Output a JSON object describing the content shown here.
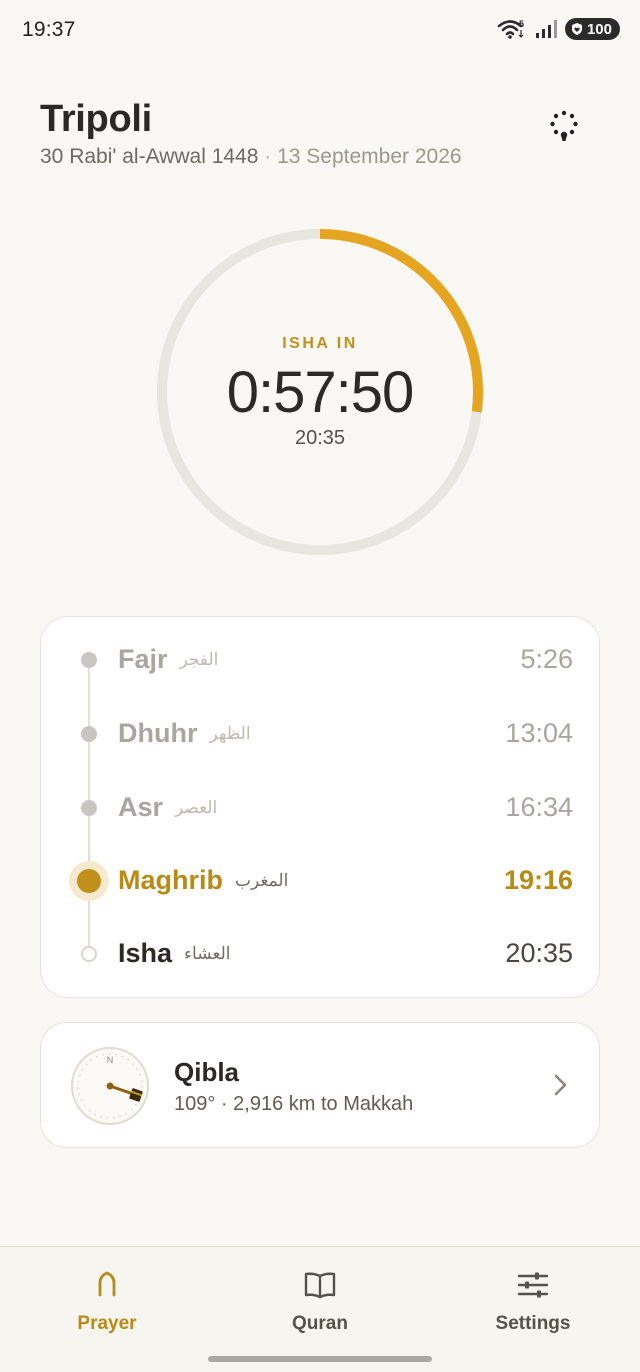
{
  "status_bar": {
    "time": "19:37",
    "battery": "100",
    "icons": [
      "wifi-icon",
      "signal-icon",
      "battery-icon"
    ]
  },
  "header": {
    "city": "Tripoli",
    "hijri_date": "30 Rabi' al-Awwal 1448",
    "separator": "·",
    "gregorian_date": "13 September 2026",
    "location_icon": "location-pin-icon"
  },
  "countdown": {
    "label": "ISHA IN",
    "remaining": "0:57:50",
    "time": "20:35",
    "progress_fraction": 0.27
  },
  "prayers": [
    {
      "name": "Fajr",
      "arabic": "الفجر",
      "time": "5:26",
      "state": "past"
    },
    {
      "name": "Dhuhr",
      "arabic": "الظهر",
      "time": "13:04",
      "state": "past"
    },
    {
      "name": "Asr",
      "arabic": "العصر",
      "time": "16:34",
      "state": "past"
    },
    {
      "name": "Maghrib",
      "arabic": "المغرب",
      "time": "19:16",
      "state": "current"
    },
    {
      "name": "Isha",
      "arabic": "العشاء",
      "time": "20:35",
      "state": "next"
    }
  ],
  "qibla": {
    "title": "Qibla",
    "subtitle": "109° · 2,916 km to Makkah",
    "compass_north": "N",
    "bearing_degrees": 109
  },
  "nav": {
    "items": [
      {
        "label": "Prayer",
        "icon": "mihrab-icon",
        "active": true
      },
      {
        "label": "Quran",
        "icon": "book-icon",
        "active": false
      },
      {
        "label": "Settings",
        "icon": "sliders-icon",
        "active": false
      }
    ]
  },
  "colors": {
    "accent": "#c0901a",
    "background": "#f9f8f4",
    "ring_track": "#e8e6e0"
  }
}
